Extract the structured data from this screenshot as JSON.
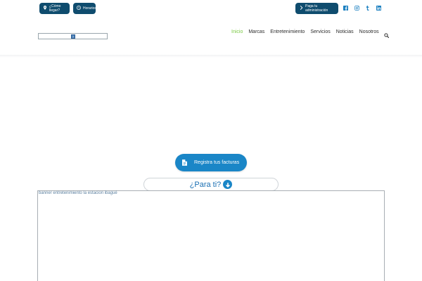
{
  "topbar": {
    "como_llegar": "¿Cómo llegar?",
    "horarios": "Horarios",
    "pago": "Paga tu administración",
    "social_icons": [
      "facebook-icon",
      "instagram-icon",
      "tumblr-icon",
      "linkedin-icon"
    ],
    "button_color": "#0f4c6e",
    "social_color": "#1a7fc0"
  },
  "logo": {
    "broken_image_glyph": "?"
  },
  "nav": {
    "items": [
      "Inicio",
      "Marcas",
      "Entretenimiento",
      "Servicios",
      "Noticias",
      "Nosotros"
    ],
    "active_index": 0,
    "active_color": "#7ac943"
  },
  "cta": {
    "registra_label": "Registra tus facturas",
    "para_ti_label": "¿Para ti?",
    "accent": "#1a86c7"
  },
  "banner": {
    "alt_text": "banner entretenimiento la estacion ibagué"
  }
}
